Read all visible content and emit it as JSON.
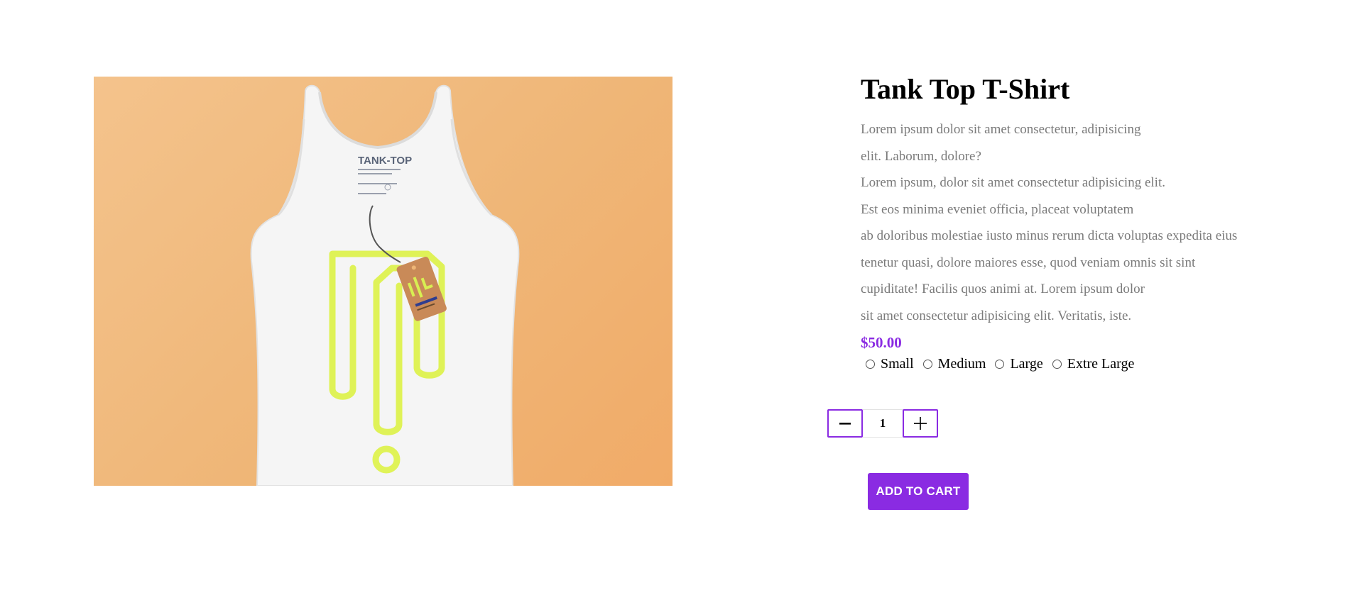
{
  "product": {
    "image_alt": "White tank top with yellow graphic and hang tag on orange background",
    "image_brand_label": "TANK-TOP",
    "title": "Tank Top T-Shirt",
    "description_lines": [
      "Lorem ipsum dolor sit amet consectetur, adipisicing",
      "elit. Laborum, dolore?",
      "Lorem ipsum, dolor sit amet consectetur adipisicing elit.",
      "Est eos minima eveniet officia, placeat voluptatem",
      "ab doloribus molestiae iusto minus rerum dicta voluptas expedita eius",
      "tenetur quasi, dolore maiores esse, quod veniam omnis sit sint",
      "cupiditate! Facilis quos animi at. Lorem ipsum dolor",
      "sit amet consectetur adipisicing elit. Veritatis, iste."
    ],
    "price": "$50.00",
    "sizes": [
      "Small",
      "Medium",
      "Large",
      "Extre Large"
    ],
    "selected_size": null
  },
  "quantity": {
    "decrement_icon": "minus-icon",
    "increment_icon": "plus-icon",
    "value": "1"
  },
  "cart": {
    "add_label": "ADD TO CART"
  },
  "colors": {
    "accent": "#8a2be2",
    "description_text": "#7a7a7a",
    "image_background": "#f0b878",
    "graphic_yellow": "#d9f23a"
  }
}
